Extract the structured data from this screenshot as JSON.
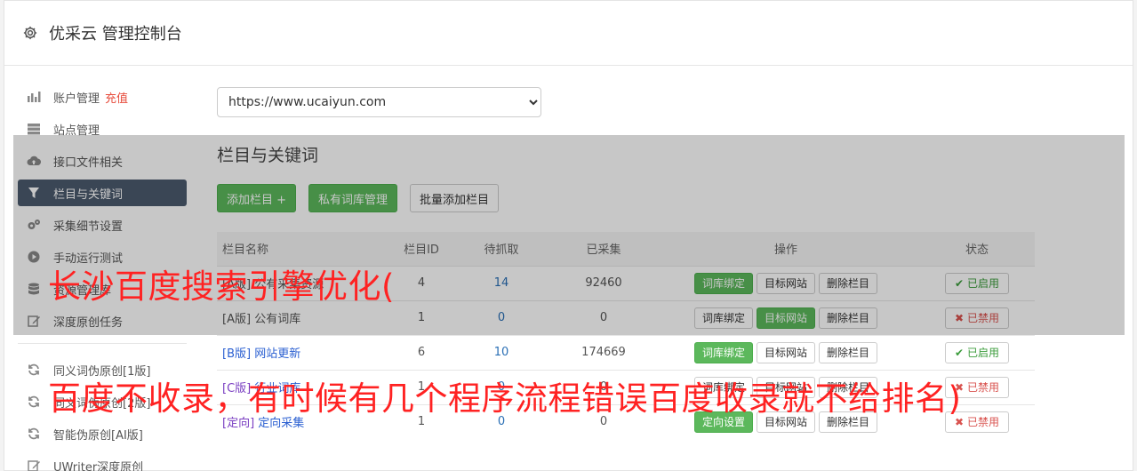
{
  "header": {
    "title": "优采云 管理控制台",
    "icon": "gear-icon"
  },
  "sidebar": {
    "items": [
      {
        "label": "账户管理",
        "badge": "充值",
        "icon": "bar-chart-icon"
      },
      {
        "label": "站点管理",
        "icon": "server-icon"
      },
      {
        "label": "接口文件相关",
        "icon": "cloud-upload-icon"
      },
      {
        "label": "栏目与关键词",
        "icon": "filter-icon",
        "active": true
      },
      {
        "label": "采集细节设置",
        "icon": "gears-icon"
      },
      {
        "label": "手动运行测试",
        "icon": "play-circle-icon"
      },
      {
        "label": "资源管理库",
        "icon": "database-icon"
      },
      {
        "label": "深度原创任务",
        "icon": "edit-icon"
      }
    ],
    "items2": [
      {
        "label": "同义词伪原创[1版]",
        "icon": "refresh-icon"
      },
      {
        "label": "同义词伪原创[2版]",
        "icon": "refresh-icon"
      },
      {
        "label": "智能伪原创[AI版]",
        "icon": "refresh-icon"
      },
      {
        "label": "UWriter深度原创",
        "icon": "edit-icon"
      }
    ]
  },
  "site_select": {
    "value": "https://www.ucaiyun.com"
  },
  "section": {
    "title": "栏目与关键词",
    "add_button": "添加栏目 +",
    "private_lib_button": "私有词库管理",
    "batch_add_button": "批量添加栏目"
  },
  "table": {
    "headers": [
      "栏目名称",
      "栏目ID",
      "待抓取",
      "已采集",
      "操作",
      "状态"
    ],
    "rows": [
      {
        "tag": "[A版]",
        "name": "公有采集资源",
        "id": "4",
        "pending": "14",
        "collected": "92460",
        "op1": "词库绑定",
        "op1_green": true,
        "op2": "目标网站",
        "op2_green": false,
        "op3": "删除栏目",
        "status": "已启用",
        "status_on": true
      },
      {
        "tag": "[A版]",
        "name": "公有词库",
        "id": "1",
        "pending": "0",
        "collected": "0",
        "op1": "词库绑定",
        "op1_green": false,
        "op2": "目标网站",
        "op2_green": true,
        "op3": "删除栏目",
        "status": "已禁用",
        "status_on": false
      },
      {
        "tag": "[B版]",
        "name": "网站更新",
        "id": "6",
        "pending": "10",
        "collected": "174669",
        "op1": "词库绑定",
        "op1_green": true,
        "op2": "目标网站",
        "op2_green": false,
        "op3": "删除栏目",
        "status": "已启用",
        "status_on": true
      },
      {
        "tag": "[C版]",
        "name": "行业词库",
        "id": "1",
        "pending": "0",
        "collected": "0",
        "op1": "词库绑定",
        "op1_green": false,
        "op2": "目标网站",
        "op2_green": false,
        "op3": "删除栏目",
        "status": "已禁用",
        "status_on": false
      },
      {
        "tag": "[定向]",
        "name": "定向采集",
        "id": "1",
        "pending": "0",
        "collected": "0",
        "op1": "定向设置",
        "op1_green": true,
        "op2": "目标网站",
        "op2_green": false,
        "op3": "删除栏目",
        "status": "已禁用",
        "status_on": false
      }
    ]
  },
  "overlay_caption": {
    "line1": "长沙百度搜索引擎优化(",
    "line2": "百度不收录，有时候有几个程序流程错误百度收录就不给排名)"
  },
  "colors": {
    "accent_green": "#5cb85c",
    "active_nav": "#4b5a6e",
    "caption_red": "#ff2222"
  }
}
